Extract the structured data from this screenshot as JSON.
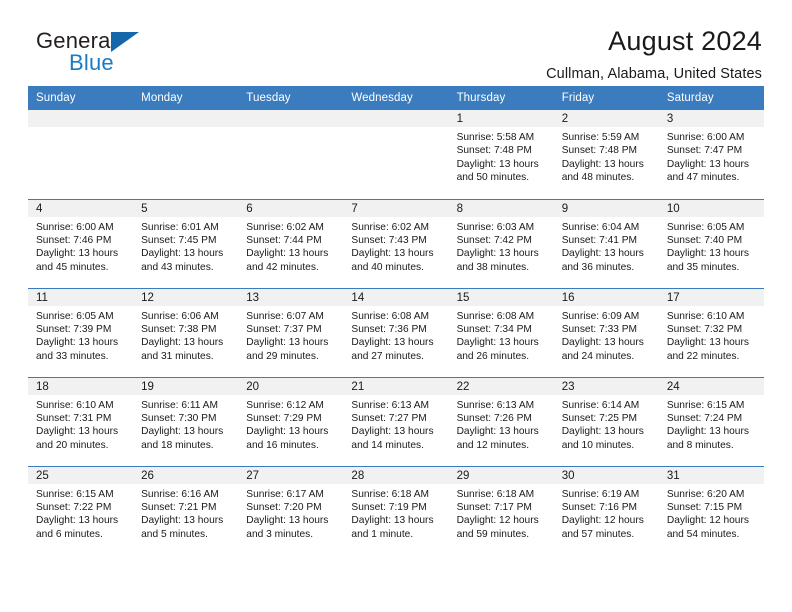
{
  "brand": {
    "name_part1": "General",
    "name_part2": "Blue",
    "triangle_color": "#1567ac",
    "blue_color": "#1a7bc4"
  },
  "header": {
    "title": "August 2024",
    "subtitle": "Cullman, Alabama, United States",
    "accent_color": "#3a7cbe",
    "band_color": "#f1f1f1"
  },
  "weekdays": [
    "Sunday",
    "Monday",
    "Tuesday",
    "Wednesday",
    "Thursday",
    "Friday",
    "Saturday"
  ],
  "labels": {
    "sunrise": "Sunrise:",
    "sunset": "Sunset:",
    "daylight": "Daylight:"
  },
  "weeks": [
    [
      {
        "day": "",
        "empty": true
      },
      {
        "day": "",
        "empty": true
      },
      {
        "day": "",
        "empty": true
      },
      {
        "day": "",
        "empty": true
      },
      {
        "day": "1",
        "sunrise": "Sunrise: 5:58 AM",
        "sunset": "Sunset: 7:48 PM",
        "daylight1": "Daylight: 13 hours",
        "daylight2": "and 50 minutes."
      },
      {
        "day": "2",
        "sunrise": "Sunrise: 5:59 AM",
        "sunset": "Sunset: 7:48 PM",
        "daylight1": "Daylight: 13 hours",
        "daylight2": "and 48 minutes."
      },
      {
        "day": "3",
        "sunrise": "Sunrise: 6:00 AM",
        "sunset": "Sunset: 7:47 PM",
        "daylight1": "Daylight: 13 hours",
        "daylight2": "and 47 minutes."
      }
    ],
    [
      {
        "day": "4",
        "sunrise": "Sunrise: 6:00 AM",
        "sunset": "Sunset: 7:46 PM",
        "daylight1": "Daylight: 13 hours",
        "daylight2": "and 45 minutes."
      },
      {
        "day": "5",
        "sunrise": "Sunrise: 6:01 AM",
        "sunset": "Sunset: 7:45 PM",
        "daylight1": "Daylight: 13 hours",
        "daylight2": "and 43 minutes."
      },
      {
        "day": "6",
        "sunrise": "Sunrise: 6:02 AM",
        "sunset": "Sunset: 7:44 PM",
        "daylight1": "Daylight: 13 hours",
        "daylight2": "and 42 minutes."
      },
      {
        "day": "7",
        "sunrise": "Sunrise: 6:02 AM",
        "sunset": "Sunset: 7:43 PM",
        "daylight1": "Daylight: 13 hours",
        "daylight2": "and 40 minutes."
      },
      {
        "day": "8",
        "sunrise": "Sunrise: 6:03 AM",
        "sunset": "Sunset: 7:42 PM",
        "daylight1": "Daylight: 13 hours",
        "daylight2": "and 38 minutes."
      },
      {
        "day": "9",
        "sunrise": "Sunrise: 6:04 AM",
        "sunset": "Sunset: 7:41 PM",
        "daylight1": "Daylight: 13 hours",
        "daylight2": "and 36 minutes."
      },
      {
        "day": "10",
        "sunrise": "Sunrise: 6:05 AM",
        "sunset": "Sunset: 7:40 PM",
        "daylight1": "Daylight: 13 hours",
        "daylight2": "and 35 minutes."
      }
    ],
    [
      {
        "day": "11",
        "sunrise": "Sunrise: 6:05 AM",
        "sunset": "Sunset: 7:39 PM",
        "daylight1": "Daylight: 13 hours",
        "daylight2": "and 33 minutes."
      },
      {
        "day": "12",
        "sunrise": "Sunrise: 6:06 AM",
        "sunset": "Sunset: 7:38 PM",
        "daylight1": "Daylight: 13 hours",
        "daylight2": "and 31 minutes."
      },
      {
        "day": "13",
        "sunrise": "Sunrise: 6:07 AM",
        "sunset": "Sunset: 7:37 PM",
        "daylight1": "Daylight: 13 hours",
        "daylight2": "and 29 minutes."
      },
      {
        "day": "14",
        "sunrise": "Sunrise: 6:08 AM",
        "sunset": "Sunset: 7:36 PM",
        "daylight1": "Daylight: 13 hours",
        "daylight2": "and 27 minutes."
      },
      {
        "day": "15",
        "sunrise": "Sunrise: 6:08 AM",
        "sunset": "Sunset: 7:34 PM",
        "daylight1": "Daylight: 13 hours",
        "daylight2": "and 26 minutes."
      },
      {
        "day": "16",
        "sunrise": "Sunrise: 6:09 AM",
        "sunset": "Sunset: 7:33 PM",
        "daylight1": "Daylight: 13 hours",
        "daylight2": "and 24 minutes."
      },
      {
        "day": "17",
        "sunrise": "Sunrise: 6:10 AM",
        "sunset": "Sunset: 7:32 PM",
        "daylight1": "Daylight: 13 hours",
        "daylight2": "and 22 minutes."
      }
    ],
    [
      {
        "day": "18",
        "sunrise": "Sunrise: 6:10 AM",
        "sunset": "Sunset: 7:31 PM",
        "daylight1": "Daylight: 13 hours",
        "daylight2": "and 20 minutes."
      },
      {
        "day": "19",
        "sunrise": "Sunrise: 6:11 AM",
        "sunset": "Sunset: 7:30 PM",
        "daylight1": "Daylight: 13 hours",
        "daylight2": "and 18 minutes."
      },
      {
        "day": "20",
        "sunrise": "Sunrise: 6:12 AM",
        "sunset": "Sunset: 7:29 PM",
        "daylight1": "Daylight: 13 hours",
        "daylight2": "and 16 minutes."
      },
      {
        "day": "21",
        "sunrise": "Sunrise: 6:13 AM",
        "sunset": "Sunset: 7:27 PM",
        "daylight1": "Daylight: 13 hours",
        "daylight2": "and 14 minutes."
      },
      {
        "day": "22",
        "sunrise": "Sunrise: 6:13 AM",
        "sunset": "Sunset: 7:26 PM",
        "daylight1": "Daylight: 13 hours",
        "daylight2": "and 12 minutes."
      },
      {
        "day": "23",
        "sunrise": "Sunrise: 6:14 AM",
        "sunset": "Sunset: 7:25 PM",
        "daylight1": "Daylight: 13 hours",
        "daylight2": "and 10 minutes."
      },
      {
        "day": "24",
        "sunrise": "Sunrise: 6:15 AM",
        "sunset": "Sunset: 7:24 PM",
        "daylight1": "Daylight: 13 hours",
        "daylight2": "and 8 minutes."
      }
    ],
    [
      {
        "day": "25",
        "sunrise": "Sunrise: 6:15 AM",
        "sunset": "Sunset: 7:22 PM",
        "daylight1": "Daylight: 13 hours",
        "daylight2": "and 6 minutes."
      },
      {
        "day": "26",
        "sunrise": "Sunrise: 6:16 AM",
        "sunset": "Sunset: 7:21 PM",
        "daylight1": "Daylight: 13 hours",
        "daylight2": "and 5 minutes."
      },
      {
        "day": "27",
        "sunrise": "Sunrise: 6:17 AM",
        "sunset": "Sunset: 7:20 PM",
        "daylight1": "Daylight: 13 hours",
        "daylight2": "and 3 minutes."
      },
      {
        "day": "28",
        "sunrise": "Sunrise: 6:18 AM",
        "sunset": "Sunset: 7:19 PM",
        "daylight1": "Daylight: 13 hours",
        "daylight2": "and 1 minute."
      },
      {
        "day": "29",
        "sunrise": "Sunrise: 6:18 AM",
        "sunset": "Sunset: 7:17 PM",
        "daylight1": "Daylight: 12 hours",
        "daylight2": "and 59 minutes."
      },
      {
        "day": "30",
        "sunrise": "Sunrise: 6:19 AM",
        "sunset": "Sunset: 7:16 PM",
        "daylight1": "Daylight: 12 hours",
        "daylight2": "and 57 minutes."
      },
      {
        "day": "31",
        "sunrise": "Sunrise: 6:20 AM",
        "sunset": "Sunset: 7:15 PM",
        "daylight1": "Daylight: 12 hours",
        "daylight2": "and 54 minutes."
      }
    ]
  ]
}
